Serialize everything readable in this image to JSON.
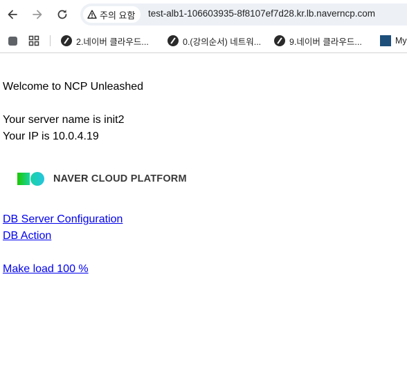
{
  "browser": {
    "security_label": "주의 요함",
    "url": "test-alb1-106603935-8f8107ef7d28.kr.lb.naverncp.com"
  },
  "bookmarks": [
    {
      "label": "2.네이버 클라우드..."
    },
    {
      "label": "0.(강의순서) 네트워..."
    },
    {
      "label": "9.네이버 클라우드..."
    },
    {
      "label": "My"
    }
  ],
  "page": {
    "welcome": "Welcome to NCP Unleashed",
    "server_name": "Your server name is init2",
    "ip": "Your IP is 10.0.4.19",
    "logo_text_bold": "NAVER",
    "logo_text_rest": " CLOUD PLATFORM",
    "links": {
      "db_config": "DB Server Configuration",
      "db_action": "DB Action",
      "make_load": "Make load 100 %"
    }
  },
  "colors": {
    "link": "#0000ee",
    "omnibox": "#edf1f6",
    "logo_green": "#1ec800",
    "logo_teal": "#19d3a2"
  }
}
